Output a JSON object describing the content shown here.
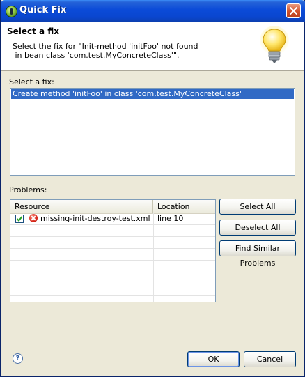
{
  "window": {
    "title": "Quick Fix",
    "icon": "eclipse-icon",
    "close_icon": "close-icon"
  },
  "header": {
    "title": "Select a fix",
    "description_line1": "Select the fix for \"Init-method 'initFoo' not found",
    "description_line2": " in bean class 'com.test.MyConcreteClass'\".",
    "image": "lightbulb-icon"
  },
  "fixes": {
    "label": "Select a fix:",
    "items": [
      {
        "label": "Create method 'initFoo' in class 'com.test.MyConcreteClass'",
        "selected": true
      }
    ]
  },
  "problems": {
    "label": "Problems:",
    "columns": [
      "Resource",
      "Location"
    ],
    "rows": [
      {
        "checked": true,
        "icon": "error-icon",
        "resource": "missing-init-destroy-test.xml",
        "location": "line 10"
      }
    ]
  },
  "side_buttons": {
    "select_all": "Select All",
    "deselect_all": "Deselect All",
    "find_similar": "Find Similar Problems"
  },
  "footer": {
    "help_icon": "help-icon",
    "ok": "OK",
    "cancel": "Cancel"
  },
  "colors": {
    "title_bar": "#0a46cf",
    "selection": "#316ac5",
    "dialog_bg": "#ece9d8"
  }
}
